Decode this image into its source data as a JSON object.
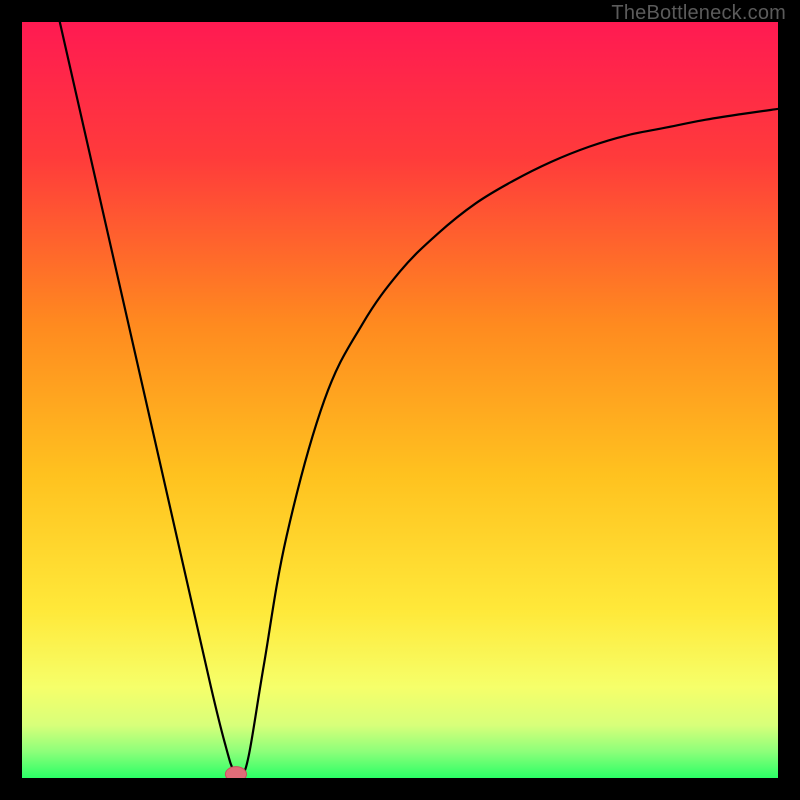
{
  "watermark": {
    "text": "TheBottleneck.com"
  },
  "colors": {
    "frame": "#000000",
    "gradient_stops": [
      {
        "offset": 0.0,
        "color": "#ff1a52"
      },
      {
        "offset": 0.18,
        "color": "#ff3b3b"
      },
      {
        "offset": 0.4,
        "color": "#ff8a1f"
      },
      {
        "offset": 0.6,
        "color": "#ffc21f"
      },
      {
        "offset": 0.78,
        "color": "#ffe93a"
      },
      {
        "offset": 0.88,
        "color": "#f6ff6a"
      },
      {
        "offset": 0.93,
        "color": "#d8ff7a"
      },
      {
        "offset": 0.965,
        "color": "#8dff7a"
      },
      {
        "offset": 1.0,
        "color": "#2bff66"
      }
    ],
    "curve": "#000000",
    "marker_fill": "#e06c78",
    "marker_stroke": "#c94f5e"
  },
  "chart_data": {
    "type": "line",
    "title": "",
    "xlabel": "",
    "ylabel": "",
    "xlim": [
      0,
      100
    ],
    "ylim": [
      0,
      100
    ],
    "grid": false,
    "legend": false,
    "series": [
      {
        "name": "bottleneck-curve",
        "x": [
          5,
          10,
          15,
          20,
          25,
          27,
          28,
          29,
          30,
          32,
          35,
          40,
          45,
          50,
          55,
          60,
          65,
          70,
          75,
          80,
          85,
          90,
          95,
          100
        ],
        "y": [
          100,
          78,
          56,
          34,
          12,
          4,
          1,
          0.5,
          3,
          15,
          32,
          50,
          60,
          67,
          72,
          76,
          79,
          81.5,
          83.5,
          85,
          86,
          87,
          87.8,
          88.5
        ]
      }
    ],
    "marker": {
      "x": 28.3,
      "y": 0.5,
      "rx": 1.4,
      "ry": 1.0
    },
    "notes": "Values are approximate readings from the raster; x and y are in percent of visible plot area (0 at left/bottom, 100 at right/top)."
  }
}
